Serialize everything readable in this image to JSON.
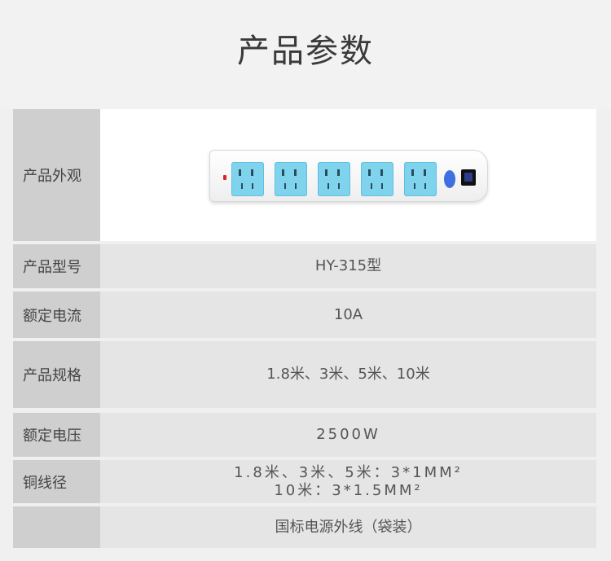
{
  "page_title": "产品参数",
  "rows": [
    {
      "label": "产品外观"
    },
    {
      "label": "产品型号",
      "value": "HY-315型"
    },
    {
      "label": "额定电流",
      "value": "10A"
    },
    {
      "label": "产品规格",
      "value": "1.8米、3米、5米、10米"
    },
    {
      "label": "额定电压",
      "value": "2500W"
    },
    {
      "label": "铜线径",
      "value_line1": "1.8米、3米、5米：3*1MM²",
      "value_line2": "10米：3*1.5MM²"
    },
    {
      "label": "",
      "value": "国标电源外线（袋装）"
    }
  ],
  "colors": {
    "label_bg": "#cfcfcf",
    "value_bg": "#e5e5e5",
    "socket": "#7fd3ec",
    "switch": "#3f6fe0"
  }
}
